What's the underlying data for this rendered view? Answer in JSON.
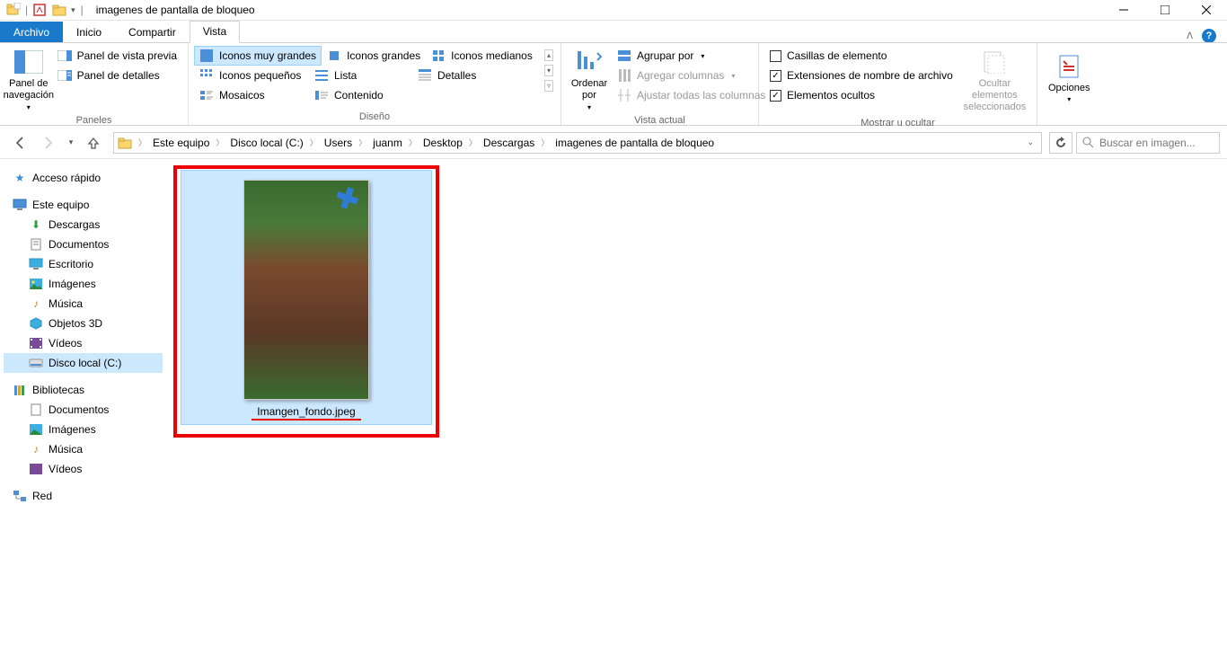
{
  "window": {
    "title": "imagenes de pantalla de bloqueo"
  },
  "tabs": {
    "file": "Archivo",
    "items": [
      "Inicio",
      "Compartir",
      "Vista"
    ],
    "active": "Vista"
  },
  "ribbon": {
    "paneles": {
      "label": "Paneles",
      "nav": "Panel de navegación",
      "preview": "Panel de vista previa",
      "details": "Panel de detalles"
    },
    "diseno": {
      "label": "Diseño",
      "views": [
        "Iconos muy grandes",
        "Iconos grandes",
        "Iconos medianos",
        "Iconos pequeños",
        "Lista",
        "Detalles",
        "Mosaicos",
        "Contenido"
      ],
      "selected": "Iconos muy grandes"
    },
    "vista_actual": {
      "label": "Vista actual",
      "ordenar": "Ordenar por",
      "agrupar": "Agrupar por",
      "agregar": "Agregar columnas",
      "ajustar": "Ajustar todas las columnas"
    },
    "mostrar": {
      "label": "Mostrar u ocultar",
      "casillas": "Casillas de elemento",
      "extensiones": "Extensiones de nombre de archivo",
      "ocultos": "Elementos ocultos",
      "ocultar_btn": "Ocultar elementos seleccionados"
    },
    "opciones": {
      "label": "Opciones"
    }
  },
  "breadcrumbs": [
    "Este equipo",
    "Disco local (C:)",
    "Users",
    "juanm",
    "Desktop",
    "Descargas",
    "imagenes de pantalla de bloqueo"
  ],
  "search": {
    "placeholder": "Buscar en imagen..."
  },
  "sidebar": {
    "quick": "Acceso rápido",
    "thispc": "Este equipo",
    "thispc_children": [
      "Descargas",
      "Documentos",
      "Escritorio",
      "Imágenes",
      "Música",
      "Objetos 3D",
      "Vídeos",
      "Disco local (C:)"
    ],
    "selected": "Disco local (C:)",
    "libraries": "Bibliotecas",
    "libraries_children": [
      "Documentos",
      "Imágenes",
      "Música",
      "Vídeos"
    ],
    "network": "Red"
  },
  "file": {
    "name": "Imangen_fondo.jpeg"
  }
}
